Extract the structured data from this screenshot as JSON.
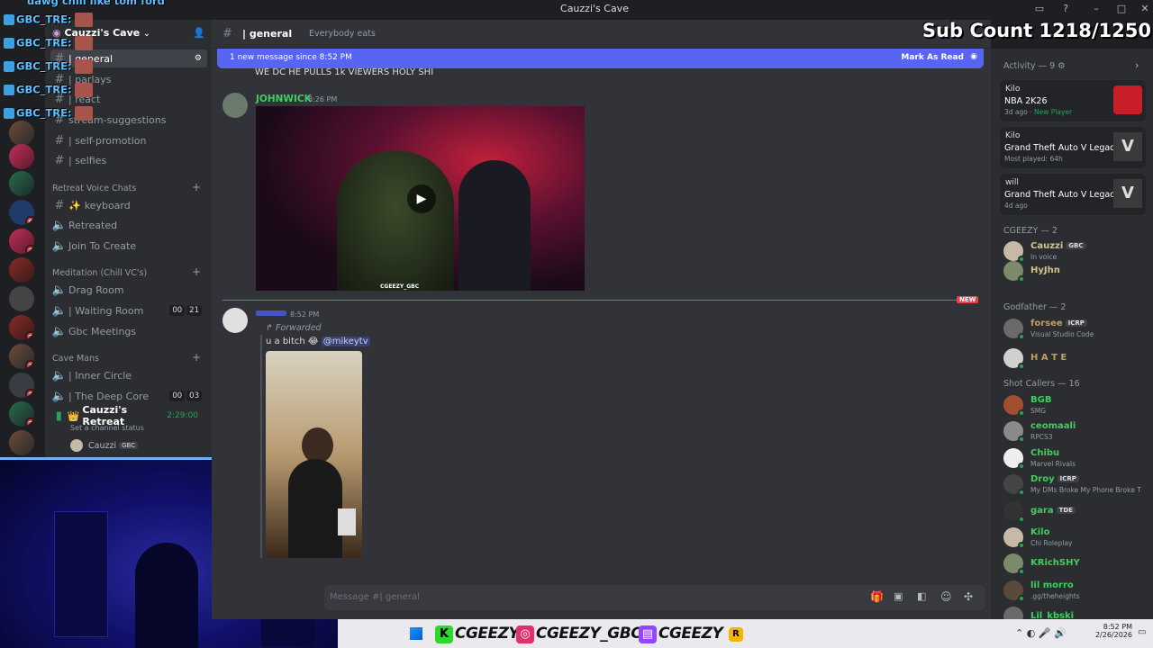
{
  "window": {
    "title": "Cauzzi's Cave"
  },
  "server": {
    "name": "Cauzzi's Cave"
  },
  "channels": [
    {
      "label": "| general",
      "selected": true
    },
    {
      "label": "| parlays"
    },
    {
      "label": "| react"
    },
    {
      "label": "stream-suggestions"
    },
    {
      "label": "| self-promotion"
    },
    {
      "label": "| selfies"
    }
  ],
  "categories": {
    "retreat_voice": "Retreat Voice Chats",
    "meditation": "Meditation (Chill VC's)",
    "cave_mans": "Cave Mans"
  },
  "retreat_channels": [
    {
      "label": "keyboard"
    },
    {
      "label": "Retreated"
    },
    {
      "label": "Join To Create"
    }
  ],
  "meditation_channels": [
    {
      "label": "Drag Room"
    },
    {
      "label": "| Waiting Room",
      "users": "00",
      "limit": "21"
    },
    {
      "label": "Gbc Meetings"
    }
  ],
  "cave_channels": [
    {
      "label": "| Inner Circle"
    },
    {
      "label": "| The Deep Core",
      "users": "00",
      "limit": "03"
    },
    {
      "label": "Cauzzi's Retreat",
      "timer": "2:29:00"
    }
  ],
  "voice_status": "Set a channel status",
  "voice_user": {
    "name": "Cauzzi",
    "tag": "GBC"
  },
  "header": {
    "channel": "| general",
    "topic": "Everybody eats"
  },
  "newbar": {
    "text": "1 new message since 8:52 PM",
    "action": "Mark As Read"
  },
  "messages": {
    "prev_text": "WE DC HE PULLS 1k VIEWERS HOLY SHI",
    "m1": {
      "author": "JOHNWICK",
      "time": "8:26 PM",
      "video_caption": "CGEEZY_GBC"
    },
    "new_label": "NEW",
    "m2": {
      "author": "",
      "time": "8:52 PM",
      "forwarded": "Forwarded",
      "text": "u a bitch 😂",
      "mention": "@mikeytv"
    }
  },
  "composer": {
    "placeholder": "Message #| general"
  },
  "activity": {
    "title": "Activity — 9",
    "items": [
      {
        "user": "Kilo",
        "game": "NBA 2K26",
        "sub": "3d ago",
        "sub2": "New Player"
      },
      {
        "user": "Kilo",
        "game": "Grand Theft Auto V Legacy",
        "sub": "Most played: 64h"
      },
      {
        "user": "will",
        "game": "Grand Theft Auto V Legacy",
        "sub": "4d ago"
      }
    ]
  },
  "groups": [
    {
      "title": "CGEEZY — 2",
      "members": [
        {
          "name": "Cauzzi",
          "tag": "GBC",
          "sub": "In voice",
          "color": "#d6c48a"
        },
        {
          "name": "HyJhn",
          "sub": "",
          "color": "#d6c48a"
        }
      ]
    },
    {
      "title": "Godfather — 2",
      "members": [
        {
          "name": "forsee",
          "tag": "ICRP",
          "sub": "Visual Studio Code",
          "color": "#c0a060"
        },
        {
          "name": "H A T E",
          "sub": "",
          "color": "#c0a060"
        }
      ]
    },
    {
      "title": "Shot Callers — 16",
      "members": [
        {
          "name": "BGB",
          "sub": "SMG",
          "color": "#3fcf5f"
        },
        {
          "name": "ceomaali",
          "sub": "RPCS3",
          "color": "#3fcf5f"
        },
        {
          "name": "Chibu",
          "sub": "Marvel Rivals",
          "color": "#3fcf5f"
        },
        {
          "name": "Droy",
          "tag": "ICRP",
          "sub": "My DMs Broke My Phone Broke T",
          "color": "#3fcf5f"
        },
        {
          "name": "gara",
          "tag": "TDE",
          "sub": "",
          "color": "#3fcf5f"
        },
        {
          "name": "Kilo",
          "sub": "Chi Roleplay",
          "color": "#3fcf5f"
        },
        {
          "name": "KRichSHY",
          "sub": "",
          "color": "#3fcf5f"
        },
        {
          "name": "lil morro",
          "sub": ".gg/theheights",
          "color": "#3fcf5f"
        },
        {
          "name": "Lil_kbski",
          "sub": "",
          "color": "#3fcf5f"
        }
      ]
    }
  ],
  "overlay": {
    "chat_top": "dawg chill like tom ford",
    "chat_user": "GBC_TRE:",
    "sub_count": "Sub Count 1218/1250"
  },
  "taskbar": {
    "kick": "CGEEZY",
    "instagram": "CGEEZY_GBC",
    "twitch": "CGEEZY",
    "time": "8:52 PM",
    "date": "2/26/2026"
  },
  "colors": {
    "accent": "#5865f2",
    "online": "#23a55a",
    "mention": "#c9cdfb",
    "new": "#f23f43"
  }
}
